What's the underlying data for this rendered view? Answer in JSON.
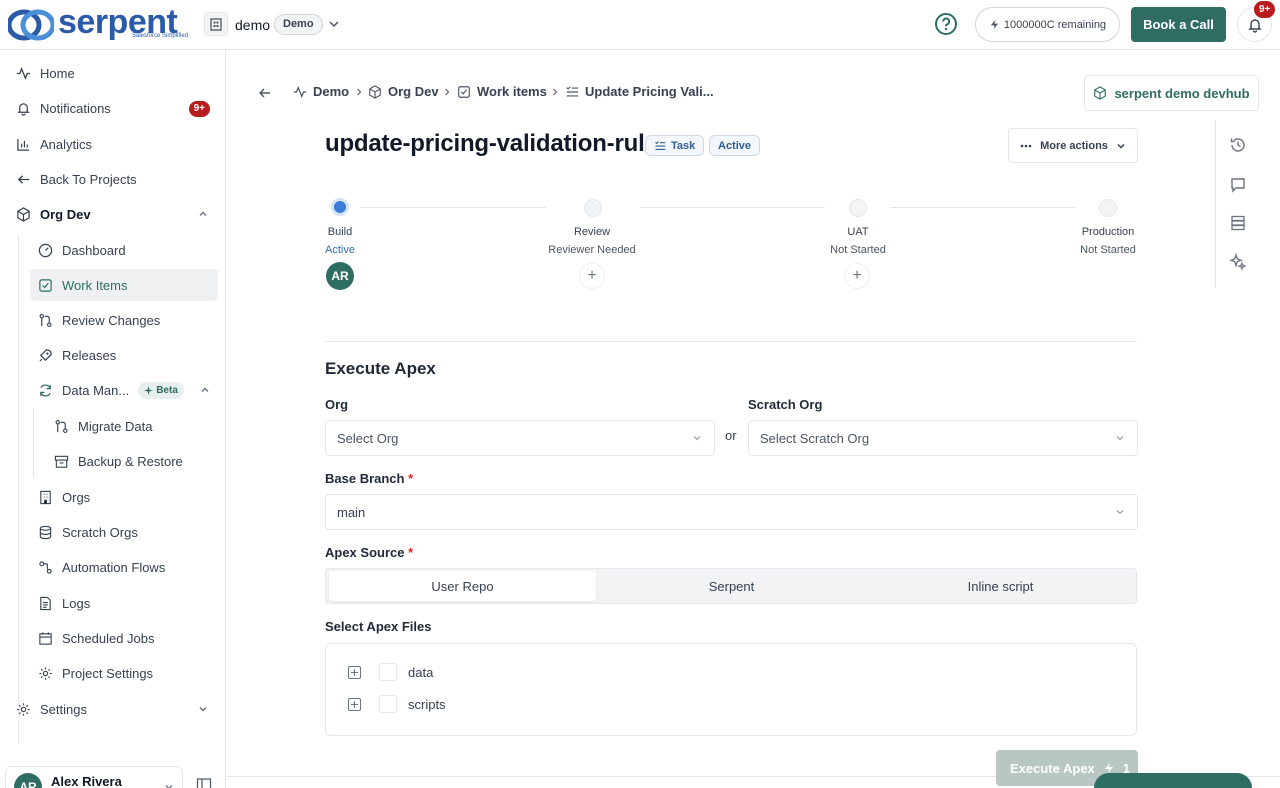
{
  "header": {
    "logo_text": "serpent",
    "logo_tagline": "Salesforce Simplified",
    "workspace_name": "demo",
    "workspace_badge": "Demo",
    "credits": "1000000C remaining",
    "book_call": "Book a Call",
    "notif_badge": "9+"
  },
  "sidebar": {
    "home": "Home",
    "notifications": "Notifications",
    "notifications_badge": "9+",
    "analytics": "Analytics",
    "back": "Back To Projects",
    "project": "Org Dev",
    "dashboard": "Dashboard",
    "work_items": "Work Items",
    "review_changes": "Review Changes",
    "releases": "Releases",
    "data_management": "Data Man...",
    "beta": "Beta",
    "migrate_data": "Migrate Data",
    "backup_restore": "Backup & Restore",
    "orgs": "Orgs",
    "scratch_orgs": "Scratch Orgs",
    "automation_flows": "Automation Flows",
    "logs": "Logs",
    "scheduled_jobs": "Scheduled Jobs",
    "project_settings": "Project Settings",
    "settings": "Settings",
    "user_initials": "AR",
    "user_name": "Alex Rivera"
  },
  "breadcrumb": {
    "items": [
      "Demo",
      "Org Dev",
      "Work items",
      "Update Pricing Vali..."
    ],
    "devhub": "serpent demo devhub"
  },
  "work_item": {
    "title": "update-pricing-validation-rules",
    "type_tag": "Task",
    "status_tag": "Active",
    "more_actions": "More actions"
  },
  "stages": [
    {
      "name": "Build",
      "status": "Active"
    },
    {
      "name": "Review",
      "status": "Reviewer Needed"
    },
    {
      "name": "UAT",
      "status": "Not Started"
    },
    {
      "name": "Production",
      "status": "Not Started"
    }
  ],
  "assignee_initials": "AR",
  "form": {
    "section_title": "Execute Apex",
    "org_label": "Org",
    "org_placeholder": "Select Org",
    "or_text": "or",
    "scratch_label": "Scratch Org",
    "scratch_placeholder": "Select Scratch Org",
    "branch_label": "Base Branch",
    "branch_value": "main",
    "required_mark": "*",
    "source_label": "Apex Source",
    "source_options": [
      "User Repo",
      "Serpent",
      "Inline script"
    ],
    "source_selected": "User Repo",
    "files_label": "Select Apex Files",
    "files": [
      "data",
      "scripts"
    ],
    "execute_button": "Execute Apex",
    "execute_cost": "1"
  },
  "colors": {
    "brand": "#2f6d63",
    "logo": "#2a5aa8",
    "badge_red": "#b91c1c",
    "stage_active": "#3b7dd8"
  }
}
